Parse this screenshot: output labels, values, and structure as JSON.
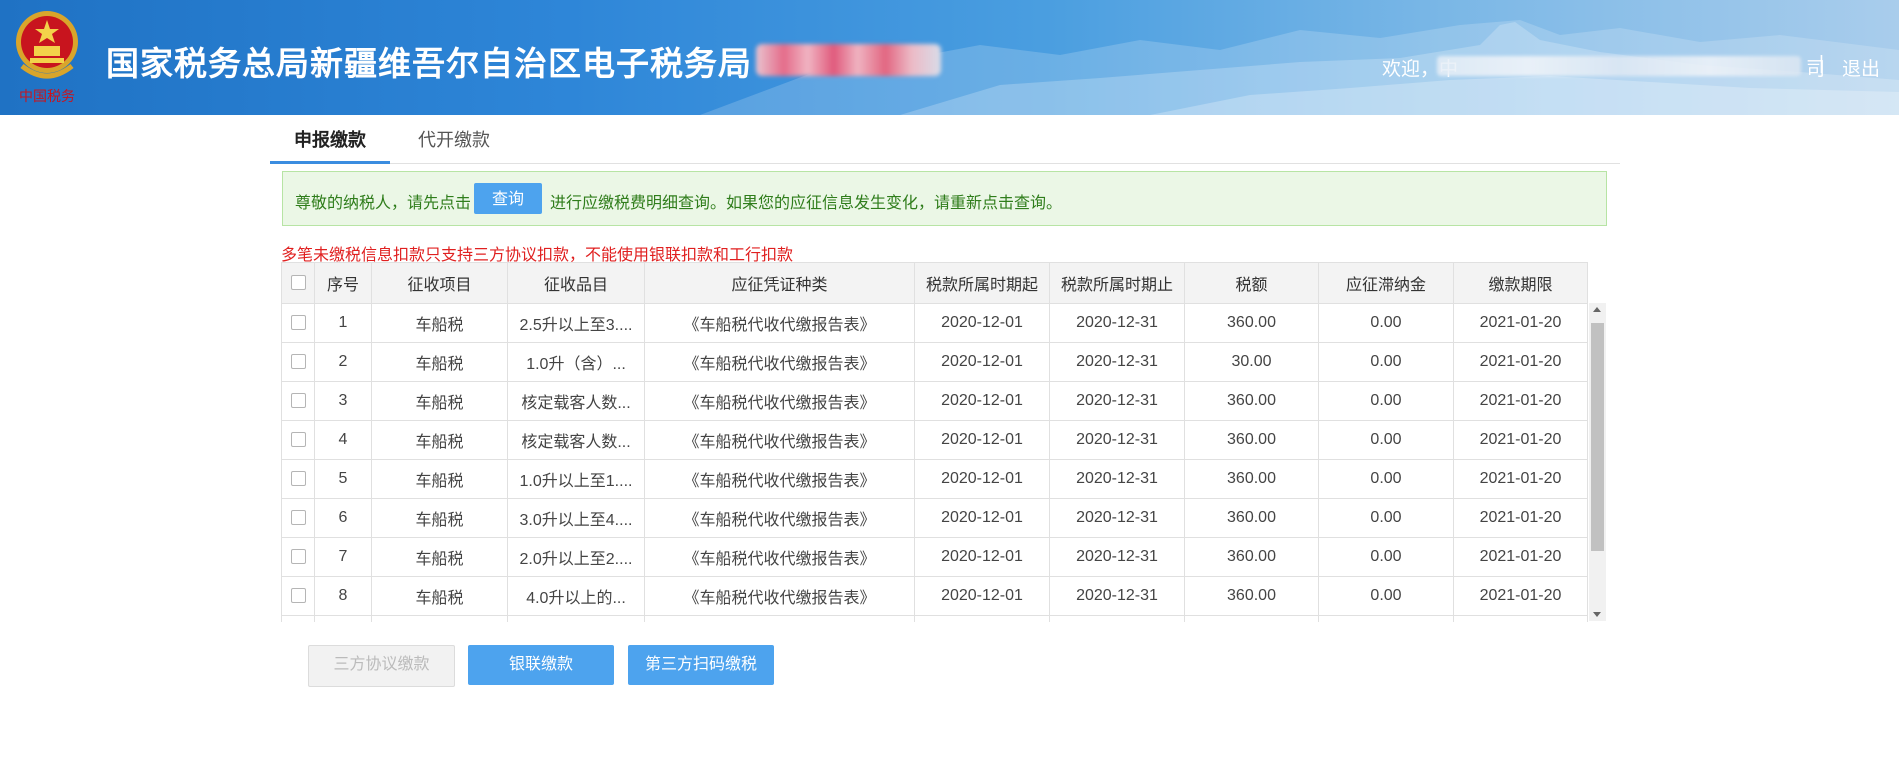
{
  "header": {
    "emblem_text": "中国税务",
    "title": "国家税务总局新疆维吾尔自治区电子税务局",
    "welcome": "欢迎，中",
    "welcome_tail": "司",
    "separator": "|",
    "logout": "退出"
  },
  "tabs": [
    {
      "label": "申报缴款",
      "active": true
    },
    {
      "label": "代开缴款",
      "active": false
    }
  ],
  "notice": {
    "text_before": "尊敬的纳税人，请先点击",
    "button": "查询",
    "text_after": "进行应缴税费明细查询。如果您的应征信息发生变化，请重新点击查询。"
  },
  "warning": "多笔未缴税信息扣款只支持三方协议扣款，不能使用银联扣款和工行扣款",
  "table": {
    "headers": [
      "序号",
      "征收项目",
      "征收品目",
      "应征凭证种类",
      "税款所属时期起",
      "税款所属时期止",
      "税额",
      "应征滞纳金",
      "缴款期限"
    ],
    "rows": [
      [
        "1",
        "车船税",
        "2.5升以上至3....",
        "《车船税代收代缴报告表》",
        "2020-12-01",
        "2020-12-31",
        "360.00",
        "0.00",
        "2021-01-20"
      ],
      [
        "2",
        "车船税",
        "1.0升（含）...",
        "《车船税代收代缴报告表》",
        "2020-12-01",
        "2020-12-31",
        "30.00",
        "0.00",
        "2021-01-20"
      ],
      [
        "3",
        "车船税",
        "核定载客人数...",
        "《车船税代收代缴报告表》",
        "2020-12-01",
        "2020-12-31",
        "360.00",
        "0.00",
        "2021-01-20"
      ],
      [
        "4",
        "车船税",
        "核定载客人数...",
        "《车船税代收代缴报告表》",
        "2020-12-01",
        "2020-12-31",
        "360.00",
        "0.00",
        "2021-01-20"
      ],
      [
        "5",
        "车船税",
        "1.0升以上至1....",
        "《车船税代收代缴报告表》",
        "2020-12-01",
        "2020-12-31",
        "360.00",
        "0.00",
        "2021-01-20"
      ],
      [
        "6",
        "车船税",
        "3.0升以上至4....",
        "《车船税代收代缴报告表》",
        "2020-12-01",
        "2020-12-31",
        "360.00",
        "0.00",
        "2021-01-20"
      ],
      [
        "7",
        "车船税",
        "2.0升以上至2....",
        "《车船税代收代缴报告表》",
        "2020-12-01",
        "2020-12-31",
        "360.00",
        "0.00",
        "2021-01-20"
      ],
      [
        "8",
        "车船税",
        "4.0升以上的...",
        "《车船税代收代缴报告表》",
        "2020-12-01",
        "2020-12-31",
        "360.00",
        "0.00",
        "2021-01-20"
      ],
      [
        "",
        "",
        "",
        "",
        "",
        "",
        "",
        "",
        ""
      ]
    ]
  },
  "buttons": {
    "three_party": "三方协议缴款",
    "unionpay": "银联缴款",
    "third_party_scan": "第三方扫码缴税"
  },
  "colors": {
    "accent": "#4da3ee",
    "header_blue": "#1f72c4",
    "notice_bg": "#ebf7e6",
    "notice_text": "#2f7d1b",
    "warning": "#e02020"
  },
  "icons": [
    "national-emblem-icon",
    "checkbox-icon",
    "scroll-up-icon",
    "scroll-down-icon"
  ]
}
